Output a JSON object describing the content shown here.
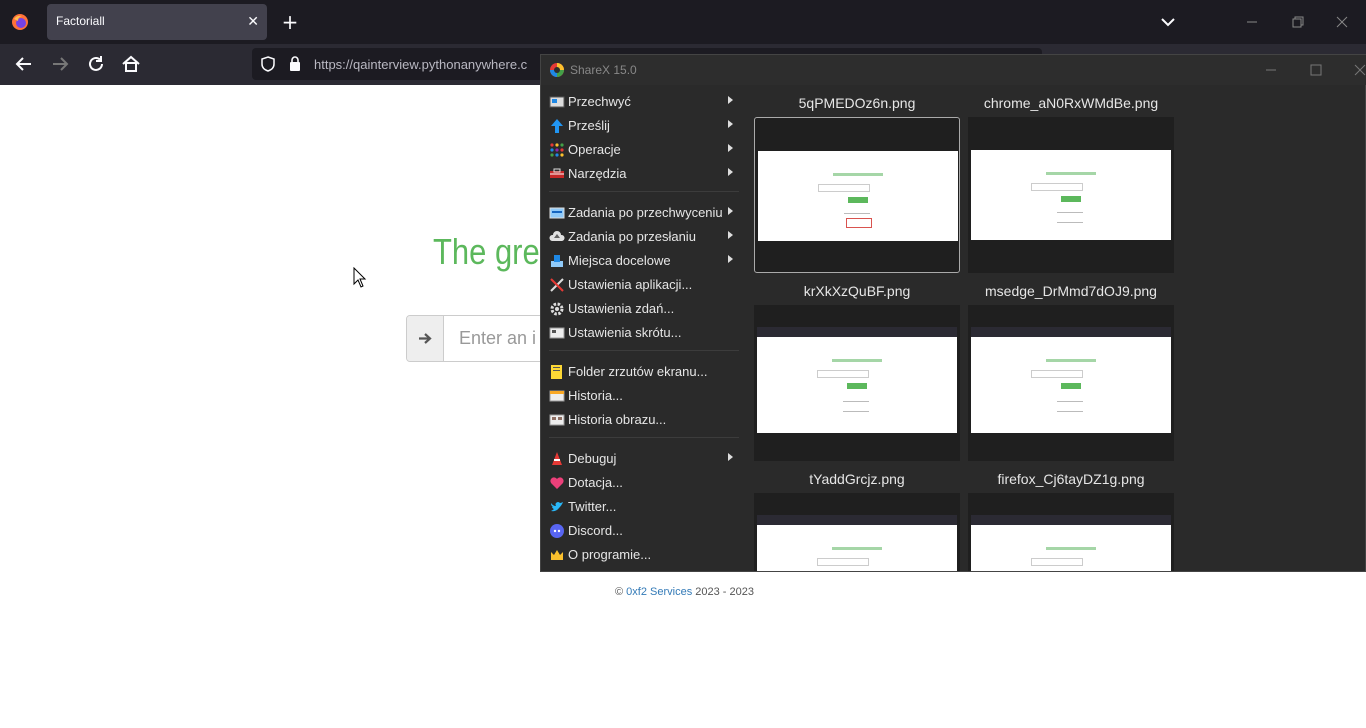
{
  "browser": {
    "tab_title": "Factoriall",
    "tab_close": "✕",
    "new_tab": "+",
    "url": "https://qainterview.pythonanywhere.c"
  },
  "page": {
    "headline": "The gre",
    "input_placeholder": "Enter an i",
    "footer_copy": "© ",
    "footer_link": "0xf2 Services",
    "footer_years": " 2023 - 2023",
    "headline_color": "#5cb85c"
  },
  "sharex": {
    "title": "ShareX 15.0",
    "menu": [
      {
        "label": "Przechwyć",
        "icon": "capture-icon",
        "arrow": true
      },
      {
        "label": "Prześlij",
        "icon": "upload-icon",
        "arrow": true
      },
      {
        "label": "Operacje",
        "icon": "workflows-icon",
        "arrow": true
      },
      {
        "label": "Narzędzia",
        "icon": "tools-icon",
        "arrow": true
      },
      {
        "label": "Zadania po przechwyceniu",
        "icon": "after-capture-icon",
        "arrow": true
      },
      {
        "label": "Zadania po przesłaniu",
        "icon": "after-upload-icon",
        "arrow": true
      },
      {
        "label": "Miejsca docelowe",
        "icon": "destinations-icon",
        "arrow": true
      },
      {
        "label": "Ustawienia aplikacji...",
        "icon": "app-settings-icon",
        "arrow": false
      },
      {
        "label": "Ustawienia zdań...",
        "icon": "task-settings-icon",
        "arrow": false
      },
      {
        "label": "Ustawienia skrótu...",
        "icon": "hotkey-settings-icon",
        "arrow": false
      },
      {
        "label": "Folder zrzutów ekranu...",
        "icon": "folder-icon",
        "arrow": false
      },
      {
        "label": "Historia...",
        "icon": "history-icon",
        "arrow": false
      },
      {
        "label": "Historia obrazu...",
        "icon": "image-history-icon",
        "arrow": false
      },
      {
        "label": "Debuguj",
        "icon": "debug-icon",
        "arrow": true
      },
      {
        "label": "Dotacja...",
        "icon": "heart-icon",
        "arrow": false
      },
      {
        "label": "Twitter...",
        "icon": "twitter-icon",
        "arrow": false
      },
      {
        "label": "Discord...",
        "icon": "discord-icon",
        "arrow": false
      },
      {
        "label": "O programie...",
        "icon": "crown-icon",
        "arrow": false
      }
    ],
    "thumbnails": [
      {
        "name": "5qPMEDOz6n.png",
        "selected": true
      },
      {
        "name": "chrome_aN0RxWMdBe.png",
        "selected": false
      },
      {
        "name": "krXkXzQuBF.png",
        "selected": false
      },
      {
        "name": "msedge_DrMmd7dOJ9.png",
        "selected": false
      },
      {
        "name": "tYaddGrcjz.png",
        "selected": false
      },
      {
        "name": "firefox_Cj6tayDZ1g.png",
        "selected": false
      }
    ]
  }
}
